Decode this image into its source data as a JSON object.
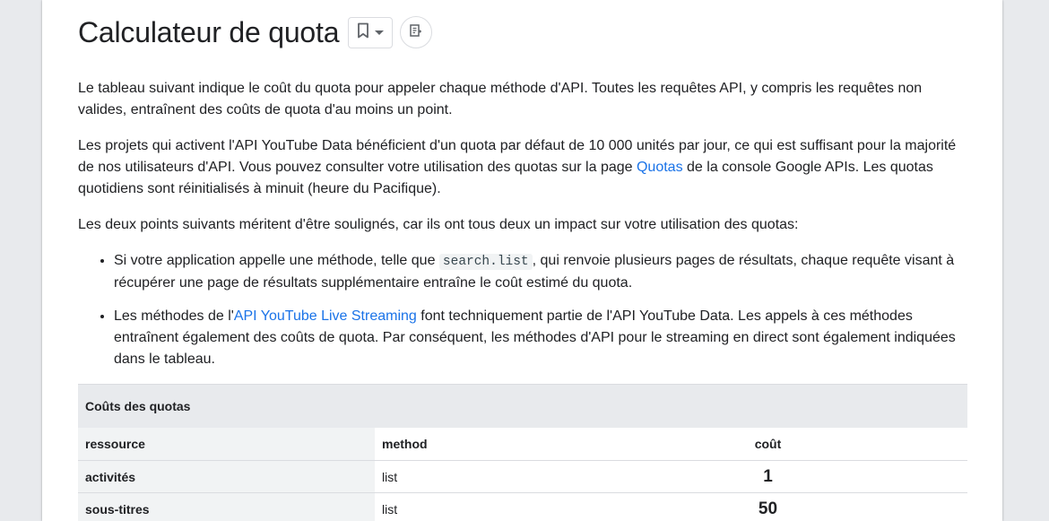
{
  "header": {
    "title": "Calculateur de quota"
  },
  "icons": {
    "bookmark": "bookmark-icon",
    "dropdown": "caret-down-icon",
    "copy": "copy-link-icon"
  },
  "paragraphs": {
    "p1": "Le tableau suivant indique le coût du quota pour appeler chaque méthode d'API. Toutes les requêtes API, y compris les requêtes non valides, entraînent des coûts de quota d'au moins un point.",
    "p2_before": "Les projets qui activent l'API YouTube Data bénéficient d'un quota par défaut de 10 000 unités par jour, ce qui est suffisant pour la majorité de nos utilisateurs d'API. Vous pouvez consulter votre utilisation des quotas sur la page ",
    "p2_link": "Quotas",
    "p2_after": " de la console Google APIs. Les quotas quotidiens sont réinitialisés à minuit (heure du Pacifique).",
    "p3": "Les deux points suivants méritent d'être soulignés, car ils ont tous deux un impact sur votre utilisation des quotas:"
  },
  "bullets": {
    "b1_before": "Si votre application appelle une méthode, telle que ",
    "b1_code": "search.list",
    "b1_after": ", qui renvoie plusieurs pages de résultats, chaque requête visant à récupérer une page de résultats supplémentaire entraîne le coût estimé du quota.",
    "b2_before": "Les méthodes de l'",
    "b2_link": "API YouTube Live Streaming",
    "b2_after": " font techniquement partie de l'API YouTube Data. Les appels à ces méthodes entraînent également des coûts de quota. Par conséquent, les méthodes d'API pour le streaming en direct sont également indiquées dans le tableau."
  },
  "table": {
    "caption": "Coûts des quotas",
    "headers": {
      "resource": "ressource",
      "method": "method",
      "cost": "coût"
    },
    "rows": [
      {
        "resource": "activités",
        "method": "list",
        "cost": "1"
      },
      {
        "resource": "sous-titres",
        "method": "list",
        "cost": "50"
      }
    ]
  },
  "colors": {
    "link": "#1a73e8",
    "text": "#202124",
    "table_header_bg": "#e8eaed",
    "resource_col_bg": "#f1f3f4"
  }
}
